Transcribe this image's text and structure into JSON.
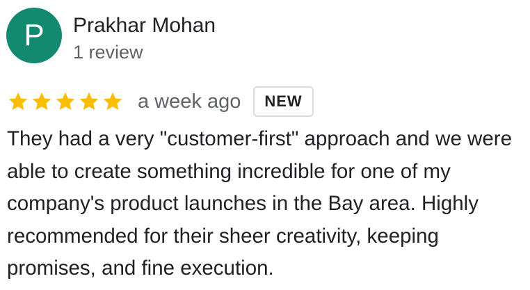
{
  "reviewer": {
    "avatar_letter": "P",
    "avatar_color": "#138a6f",
    "name": "Prakhar Mohan",
    "review_count": "1 review"
  },
  "review": {
    "rating": 5,
    "max_rating": 5,
    "star_color": "#fbbc04",
    "icon": "star-icon",
    "date": "a week ago",
    "badge": "NEW",
    "text": "They had a very \"customer-first\" approach and we were able to create something incredible for one of my company's product launches in the Bay area. Highly recommended for their sheer creativity, keeping promises, and fine execution."
  }
}
